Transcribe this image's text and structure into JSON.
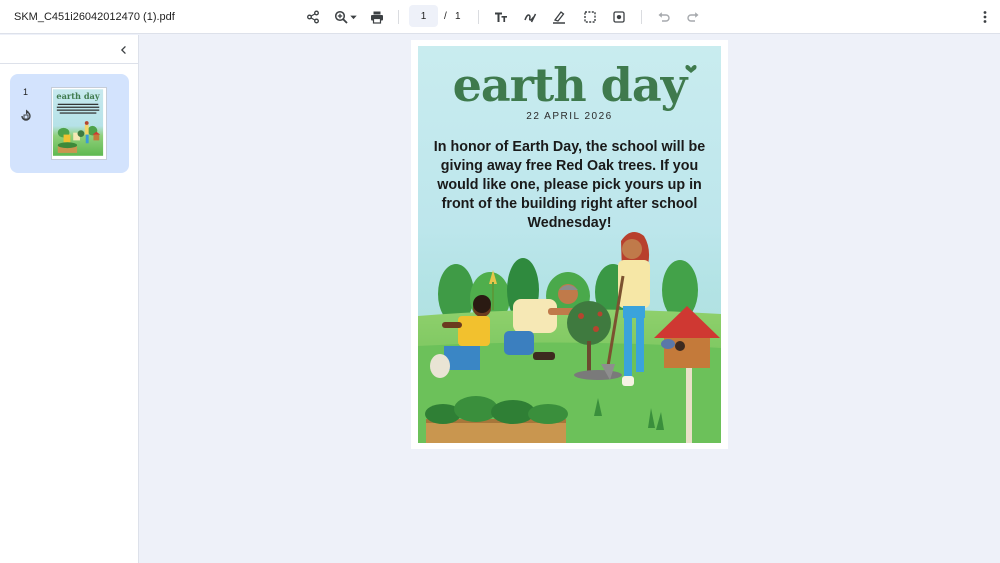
{
  "toolbar": {
    "file_name": "SKM_C451i26042012470 (1).pdf",
    "current_page": "1",
    "separator": "/",
    "total_pages": "1"
  },
  "sidebar": {
    "thumbnails": [
      {
        "page_number": "1",
        "heading": "earth day",
        "body": "In honor of Earth Day, the school will be giving away free Red Oak trees. If you would like one, please pick yours up in front of the building right after school Wednesday!"
      }
    ]
  },
  "document": {
    "heading": "earth day",
    "date": "22 APRIL 2026",
    "body": "In honor of Earth Day, the school will be giving away free Red Oak trees. If you would like one, please pick yours up in front of the building right after school Wednesday!"
  },
  "colors": {
    "accent": "#3f7a4d",
    "thumb_selected": "#d3e3fd",
    "viewer_bg": "#eef1f9",
    "sky_top": "#bfe6ee",
    "grass": "#6cc15a"
  }
}
